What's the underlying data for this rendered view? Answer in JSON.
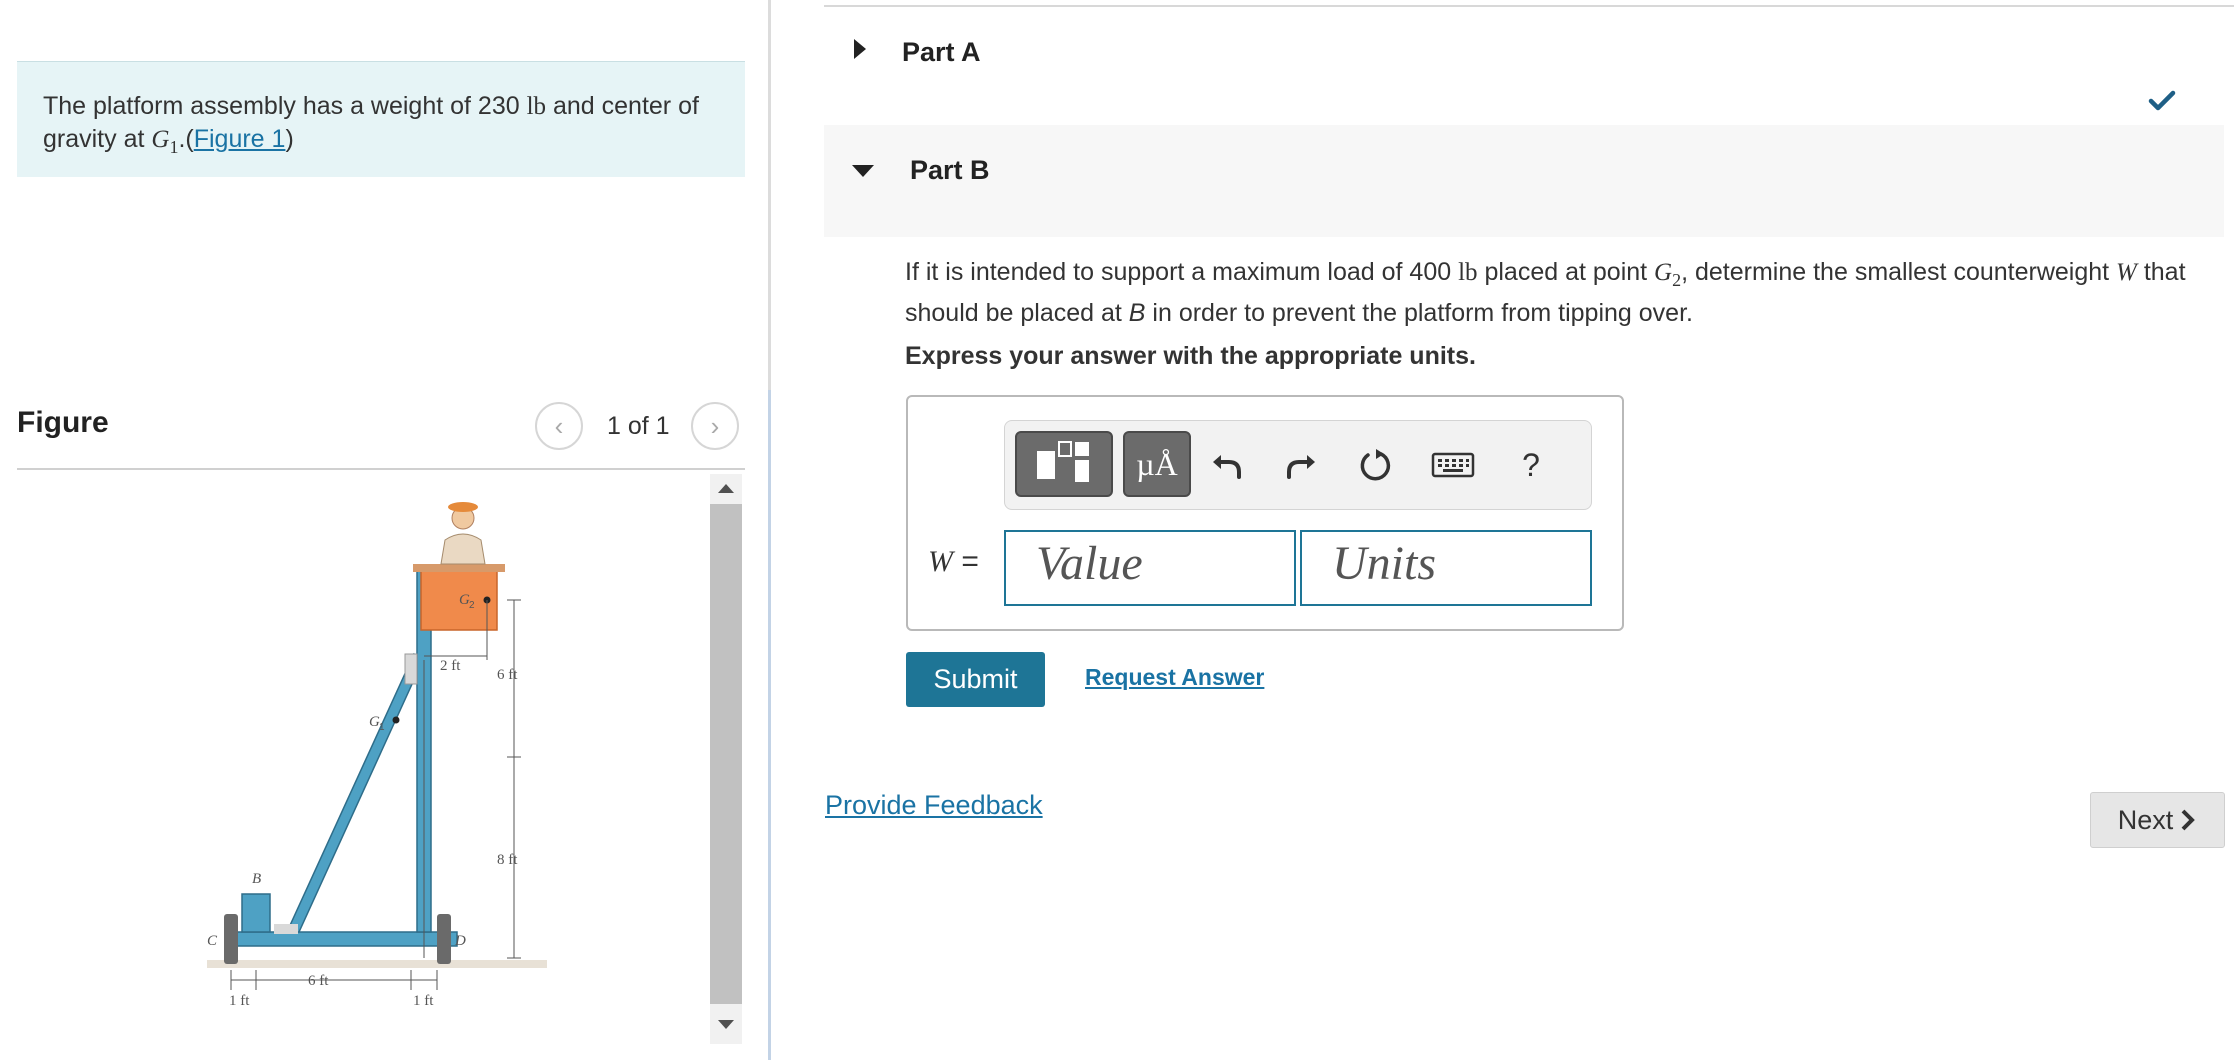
{
  "problem": {
    "text_before": "The platform assembly has a weight of 230 ",
    "unit_lb": "lb",
    "text_mid": " and center of gravity at ",
    "g_symbol": "G",
    "g_sub": "1",
    "text_after": ".",
    "figure_link": "Figure 1",
    "paren_open": "(",
    "paren_close": ")"
  },
  "figure_panel": {
    "title": "Figure",
    "page_label": "1 of 1",
    "prev_icon": "chevron-left-icon",
    "next_icon": "chevron-right-icon",
    "diagram_labels": {
      "g2": "G",
      "g2_sub": "2",
      "g1": "G",
      "g1_sub": "1",
      "b": "B",
      "c": "C",
      "d": "D",
      "dim_2ft": "2 ft",
      "dim_6ft_v": "6 ft",
      "dim_8ft": "8 ft",
      "dim_6ft_h": "6 ft",
      "dim_1ft_left": "1 ft",
      "dim_1ft_right": "1 ft"
    }
  },
  "part_a": {
    "label": "Part A",
    "status_icon": "checkmark-icon"
  },
  "part_b": {
    "label": "Part B",
    "q_before": "If it is intended to support a maximum load of 400 ",
    "q_unit": "lb",
    "q_mid": " placed at point ",
    "q_g": "G",
    "q_g_sub": "2",
    "q_mid2": ", determine the smallest counterweight ",
    "q_w": "W",
    "q_mid3": " that should be placed at ",
    "q_b": "B",
    "q_after": " in order to prevent the platform from tipping over.",
    "instruction": "Express your answer with the appropriate units.",
    "toolbar": {
      "units_button_label": "µÅ",
      "help_label": "?",
      "icons": [
        "templates-icon",
        "undo-icon",
        "redo-icon",
        "reset-icon",
        "keyboard-icon"
      ]
    },
    "answer": {
      "variable": "W",
      "equals": " =",
      "value_placeholder": "Value",
      "units_placeholder": "Units"
    },
    "submit_label": "Submit",
    "request_answer_label": "Request Answer"
  },
  "footer": {
    "feedback_label": "Provide Feedback",
    "next_label": "Next"
  },
  "colors": {
    "accent": "#1e7596",
    "link": "#1a73a4",
    "problem_bg": "#e6f4f6",
    "figure_frame": "#4ea1c4",
    "figure_tub": "#f08a4b"
  }
}
